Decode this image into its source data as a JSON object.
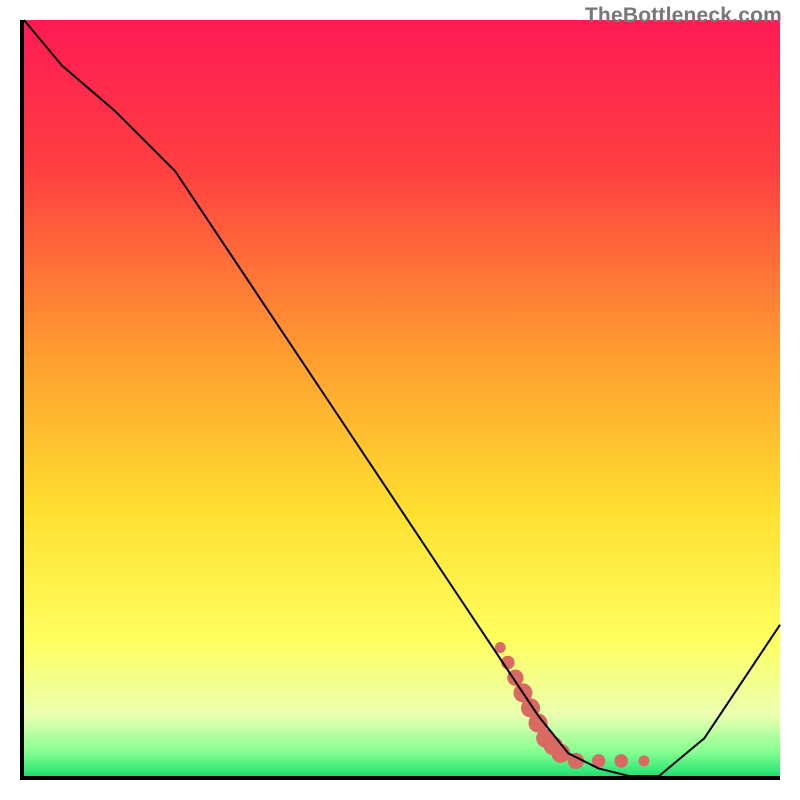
{
  "watermark": "TheBottleneck.com",
  "chart_data": {
    "type": "line",
    "title": "",
    "xlabel": "",
    "ylabel": "",
    "xlim": [
      0,
      100
    ],
    "ylim": [
      0,
      100
    ],
    "gradient_stops": [
      {
        "offset": 0,
        "color": "#ff1a55"
      },
      {
        "offset": 20,
        "color": "#ff4040"
      },
      {
        "offset": 45,
        "color": "#ffa030"
      },
      {
        "offset": 65,
        "color": "#ffe030"
      },
      {
        "offset": 82,
        "color": "#ffff60"
      },
      {
        "offset": 92,
        "color": "#eaffb0"
      },
      {
        "offset": 97,
        "color": "#80ff90"
      },
      {
        "offset": 100,
        "color": "#20e070"
      }
    ],
    "series": [
      {
        "name": "bottleneck-curve",
        "color": "#000000",
        "stroke_width": 2,
        "x": [
          0,
          5,
          12,
          20,
          30,
          40,
          50,
          58,
          64,
          68,
          72,
          76,
          80,
          84,
          90,
          100
        ],
        "y": [
          100,
          94,
          88,
          80,
          65,
          50,
          35,
          23,
          14,
          8,
          3,
          1,
          0,
          0,
          5,
          20
        ]
      }
    ],
    "highlight": {
      "name": "target-region",
      "color": "#d86a62",
      "points": [
        {
          "x": 63,
          "y": 17,
          "r": 4
        },
        {
          "x": 64,
          "y": 15,
          "r": 5
        },
        {
          "x": 65,
          "y": 13,
          "r": 6
        },
        {
          "x": 66,
          "y": 11,
          "r": 7
        },
        {
          "x": 67,
          "y": 9,
          "r": 7
        },
        {
          "x": 68,
          "y": 7,
          "r": 7
        },
        {
          "x": 69,
          "y": 5,
          "r": 7
        },
        {
          "x": 70,
          "y": 4,
          "r": 7
        },
        {
          "x": 71,
          "y": 3,
          "r": 7
        },
        {
          "x": 73,
          "y": 2,
          "r": 6
        },
        {
          "x": 76,
          "y": 2,
          "r": 5
        },
        {
          "x": 79,
          "y": 2,
          "r": 5
        },
        {
          "x": 82,
          "y": 2,
          "r": 4
        }
      ]
    }
  }
}
